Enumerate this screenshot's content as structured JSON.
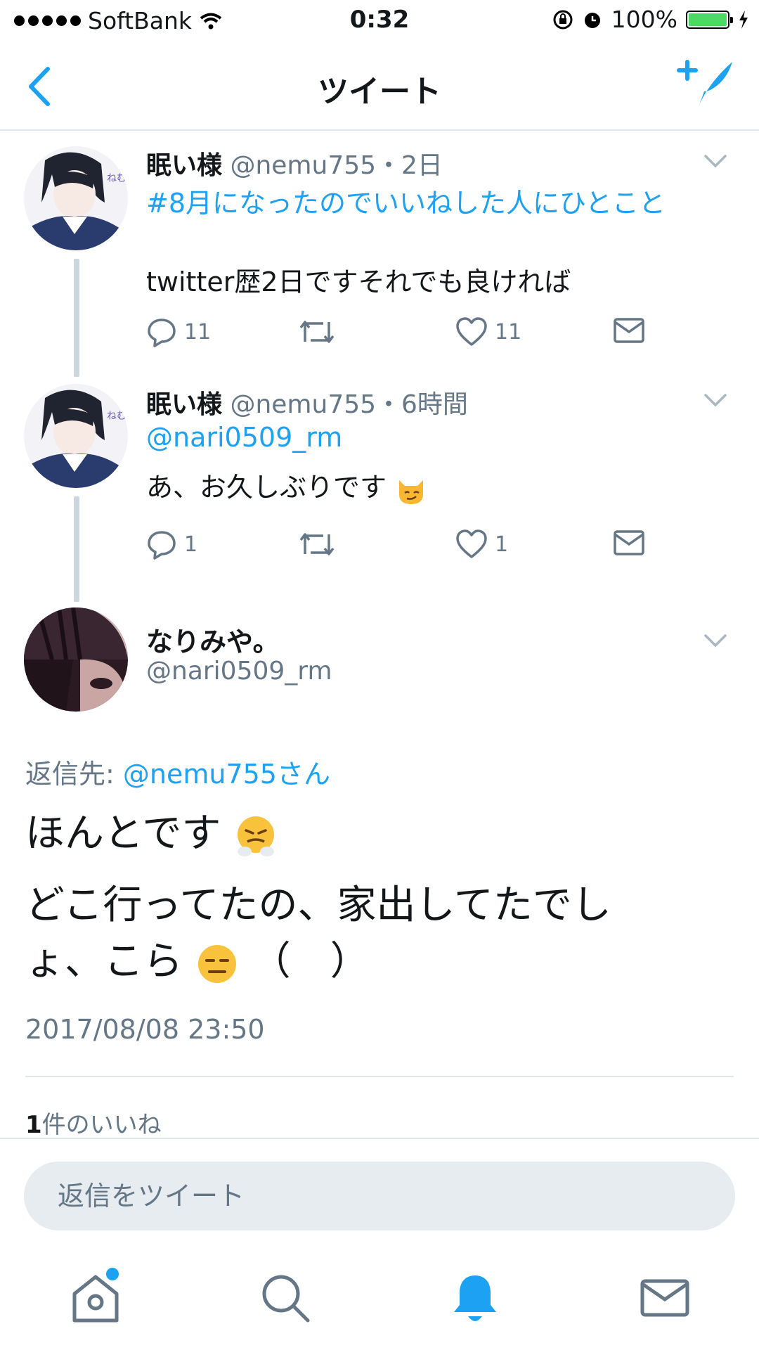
{
  "status_bar": {
    "carrier": "SoftBank",
    "time": "0:32",
    "battery": "100%",
    "battery_level": 1.0
  },
  "nav": {
    "title": "ツイート"
  },
  "tweets": [
    {
      "name": "眠い様",
      "handle_time": "@nemu755・2日",
      "hashtag": "#8月になったのでいいねした人にひとこと",
      "text": "twitter歴2日ですそれでも良ければ",
      "reply_count": "11",
      "like_count": "11"
    },
    {
      "name": "眠い様",
      "handle_time": "@nemu755・6時間",
      "mention": "@nari0509_rm",
      "text": "あ、お久しぶりです",
      "reply_count": "1",
      "like_count": "1"
    }
  ],
  "focus": {
    "name": "なりみや。",
    "handle": "@nari0509_rm",
    "reply_to_label": "返信先: ",
    "reply_to_user": "@nemu755さん",
    "line1": "ほんとです",
    "line2": "どこ行ってたの、家出してたでし",
    "line3a": "ょ、こら",
    "line3b": "（　）",
    "timestamp": "2017/08/08 23:50",
    "likes_count": "1",
    "likes_label": "件のいいね"
  },
  "reply": {
    "placeholder": "返信をツイート"
  },
  "icons": {
    "back": "chevron-left-icon",
    "compose": "compose-tweet-icon",
    "reply": "reply-icon",
    "retweet": "retweet-icon",
    "like": "heart-icon",
    "dm": "envelope-icon",
    "home": "home-icon",
    "search": "search-icon",
    "notifications": "bell-icon",
    "messages": "envelope-icon"
  },
  "colors": {
    "accent": "#1da1f2",
    "secondary_text": "#657786",
    "border": "#e1e8ed"
  }
}
